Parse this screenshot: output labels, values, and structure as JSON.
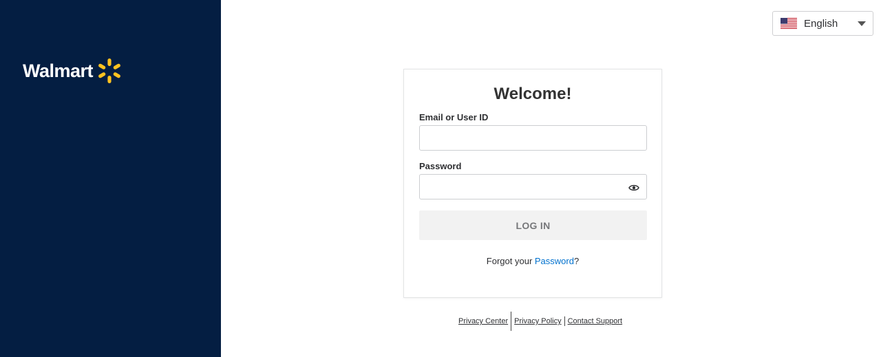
{
  "brand": {
    "name": "Walmart",
    "sidebar_color": "#041e42",
    "spark_color": "#ffc220"
  },
  "language": {
    "selected": "English",
    "flag_icon": "us-flag-icon"
  },
  "login": {
    "title": "Welcome!",
    "email_label": "Email or User ID",
    "email_value": "",
    "password_label": "Password",
    "password_value": "",
    "login_button": "LOG IN",
    "forgot_prefix": "Forgot your ",
    "forgot_link": "Password",
    "forgot_suffix": "?",
    "link_color": "#0071ce"
  },
  "footer": {
    "links": [
      "Privacy Center",
      "Privacy Policy",
      "Contact Support"
    ]
  }
}
